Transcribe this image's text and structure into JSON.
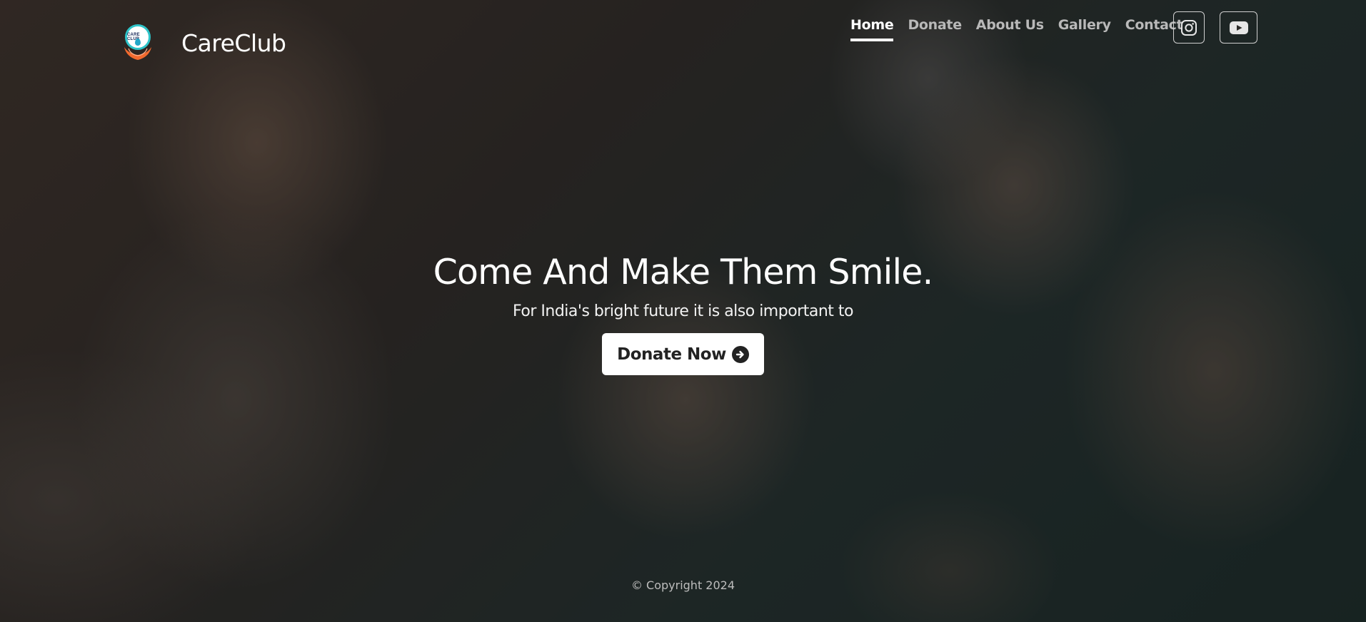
{
  "header": {
    "logo_text": "CARE CLUB",
    "brand_name": "CareClub",
    "nav": [
      {
        "label": "Home",
        "active": true
      },
      {
        "label": "Donate",
        "active": false
      },
      {
        "label": "About Us",
        "active": false
      },
      {
        "label": "Gallery",
        "active": false
      },
      {
        "label": "Contact",
        "active": false
      }
    ],
    "social": [
      {
        "icon": "instagram-icon"
      },
      {
        "icon": "youtube-icon"
      }
    ]
  },
  "hero": {
    "title": "Come And Make Them Smile.",
    "subtitle": "For India's bright future it is also important to",
    "cta_label": "Donate Now",
    "cta_icon": "arrow-circle-right-icon"
  },
  "footer": {
    "copyright": "© Copyright 2024"
  },
  "colors": {
    "accent": "#ffffff",
    "nav_inactive": "#b9b9b9",
    "logo_ring": "#2ec4c9",
    "logo_hands": "#f26a2e"
  }
}
